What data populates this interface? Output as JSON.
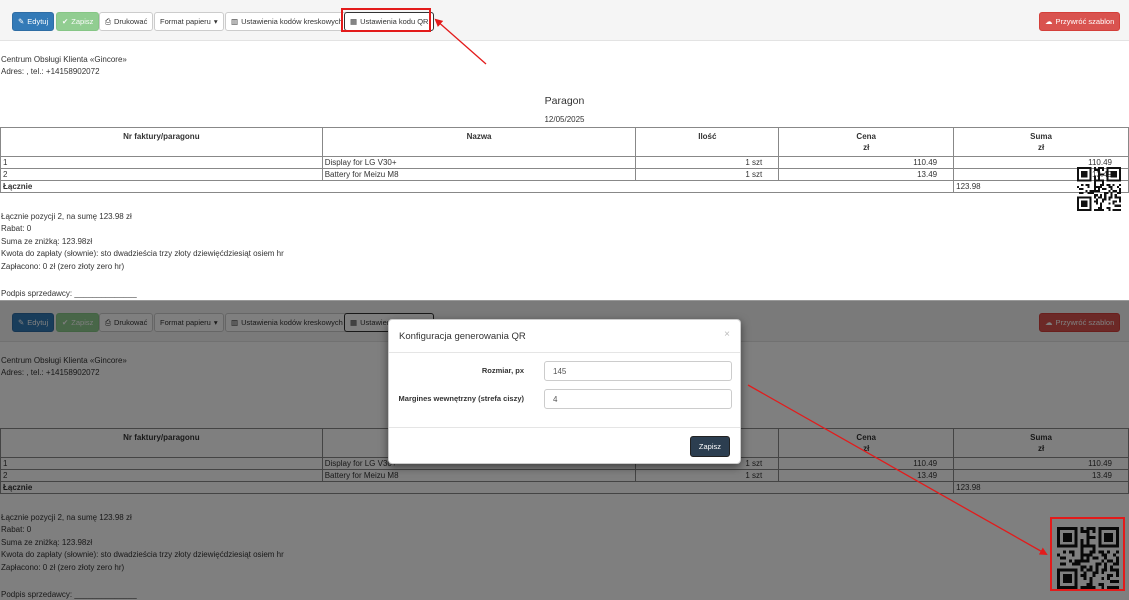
{
  "toolbar": {
    "edit_label": "Edytuj",
    "save_label": "Zapisz",
    "print_label": "Drukować",
    "paper_format_label": "Format papieru",
    "barcode_settings_label": "Ustawienia kodów kreskowych",
    "qr_settings_label": "Ustawienia kodu QR",
    "restore_template_label": "Przywróć szablon"
  },
  "icons": {
    "edit": "pencil-icon",
    "save": "check-icon",
    "print": "printer-icon",
    "paper_format": "caret-down-icon",
    "barcode": "barcode-icon",
    "qr": "qrcode-icon",
    "restore": "cloud-upload-icon",
    "close": "close-icon"
  },
  "colors": {
    "primary": "#337ab7",
    "success": "#5cb85c",
    "danger": "#d9534f",
    "modal_save": "#2c3e50",
    "annotation": "#e31b1b"
  },
  "document": {
    "company_name": "Centrum Obsługi Klienta «Gincore»",
    "address": "Adres: , tel.: +14158902072",
    "title": "Paragon",
    "date": "12/05/2025",
    "columns": {
      "invoice": "Nr faktury/paragonu",
      "name": "Nazwa",
      "quantity": "Ilość",
      "price": "Cena",
      "price_unit": "zł",
      "sum": "Suma",
      "sum_unit": "zł"
    },
    "rows": [
      {
        "no": "1",
        "name": "Display for LG V30+",
        "qty": "1 szt",
        "price": "110.49",
        "sum": "110.49"
      },
      {
        "no": "2",
        "name": "Battery for Meizu M8",
        "qty": "1 szt",
        "price": "13.49",
        "sum": "13.49"
      }
    ],
    "total_label": "Łącznie",
    "total_value": "123.98",
    "summary": {
      "positions": "Łącznie pozycji 2, na sumę 123.98 zł",
      "discount": "Rabat: 0",
      "sum_with_discount": "Suma ze zniżką: 123.98zł",
      "amount_in_words": "Kwota do zapłaty (słownie): sto dwadzieścia trzy złoty dziewięćdziesiąt osiem hr",
      "paid": "Zapłacono: 0 zł (zero złoty zero hr)"
    },
    "signature": "Podpis sprzedawcy: ______________"
  },
  "modal": {
    "title": "Konfiguracja generowania QR",
    "close_symbol": "×",
    "size_label": "Rozmiar, px",
    "size_value": "145",
    "margin_label": "Margines wewnętrzny (strefa ciszy)",
    "margin_value": "4",
    "save_label": "Zapisz"
  }
}
